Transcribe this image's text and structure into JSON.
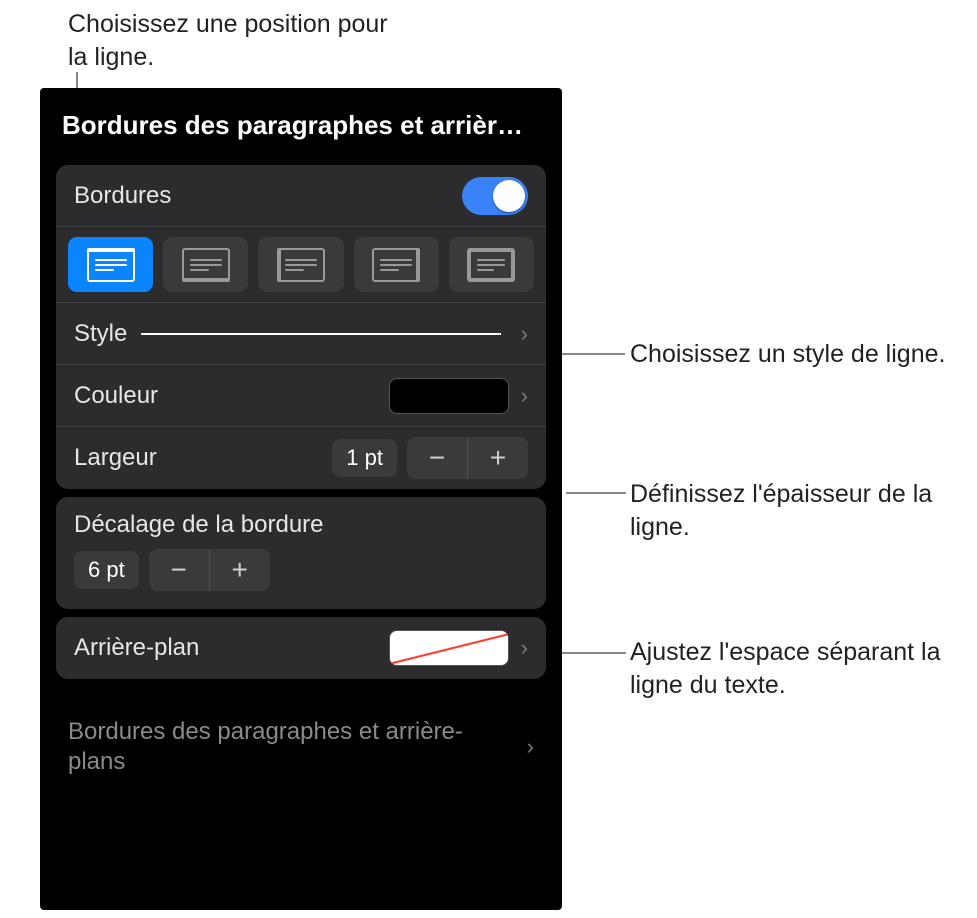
{
  "callouts": {
    "position": "Choisissez une position pour la ligne.",
    "style": "Choisissez un style de ligne.",
    "width": "Définissez l'épaisseur de la ligne.",
    "offset": "Ajustez l'espace séparant la ligne du texte."
  },
  "panel": {
    "title": "Bordures des paragraphes et arrièr…",
    "borders_label": "Bordures",
    "borders_on": true,
    "style_label": "Style",
    "color_label": "Couleur",
    "width_label": "Largeur",
    "width_value": "1 pt",
    "offset_section": "Décalage de la bordure",
    "offset_value": "6 pt",
    "background_label": "Arrière-plan",
    "bottom_nav": "Bordures des paragraphes et arrière-plans"
  },
  "colors": {
    "accent": "#0a84ff",
    "swatch": "#000000",
    "bg_swatch": "#ffffff"
  },
  "positions": [
    "top",
    "bottom",
    "left",
    "right",
    "all"
  ],
  "selected_position": 0
}
